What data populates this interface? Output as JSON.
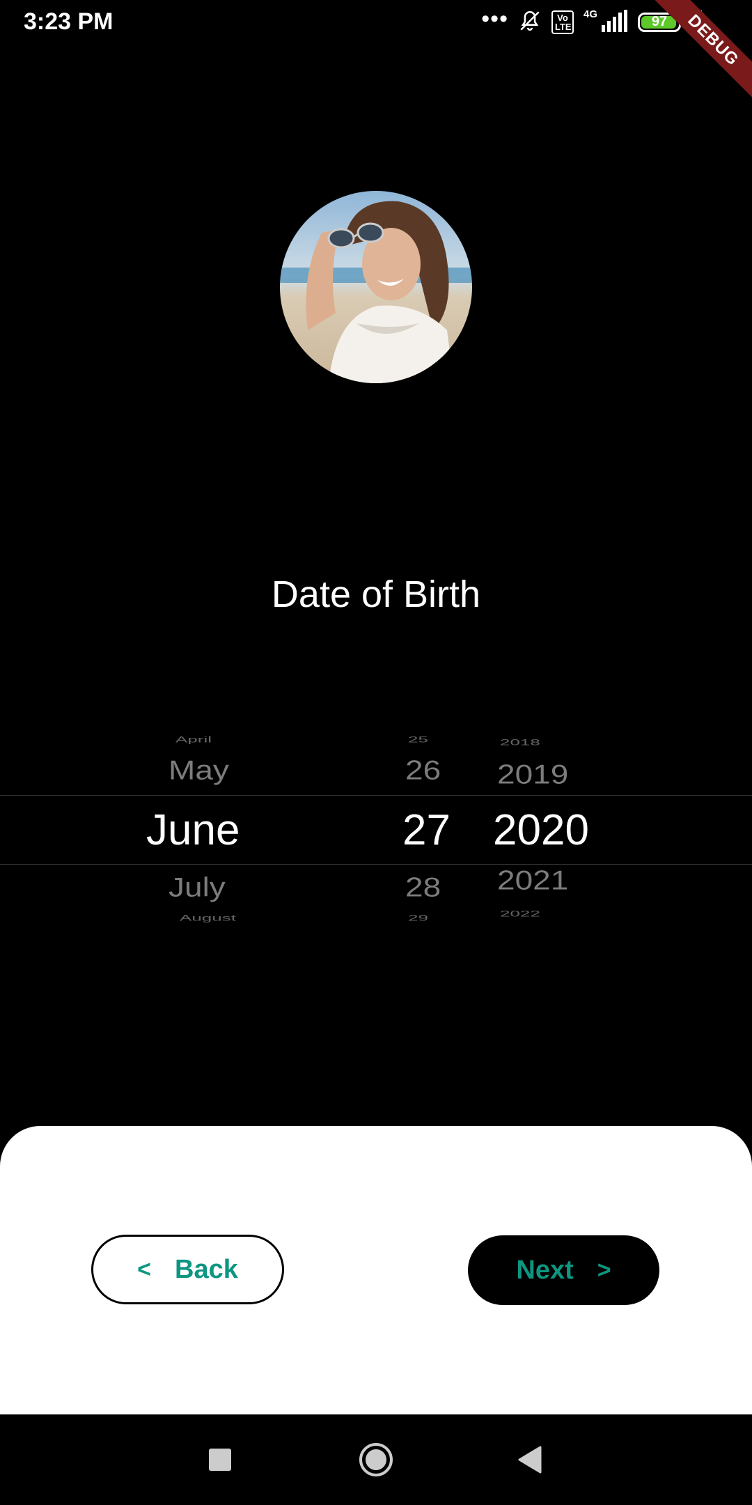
{
  "status_bar": {
    "time": "3:23 PM",
    "dots": "•••",
    "volte": "Vo LTE",
    "network": "4G",
    "battery": "97",
    "icons": [
      "mute-icon",
      "volte-icon",
      "signal-icon",
      "battery-icon",
      "charging-icon"
    ]
  },
  "debug_banner": "DEBUG",
  "title": "Date of Birth",
  "picker": {
    "months": [
      "April",
      "May",
      "June",
      "July",
      "August"
    ],
    "days": [
      "25",
      "26",
      "27",
      "28",
      "29"
    ],
    "years": [
      "2018",
      "2019",
      "2020",
      "2021",
      "2022"
    ],
    "selected": {
      "month": "June",
      "day": "27",
      "year": "2020"
    }
  },
  "buttons": {
    "back": {
      "icon": "<",
      "label": "Back"
    },
    "next": {
      "label": "Next",
      "icon": ">"
    }
  },
  "colors": {
    "accent": "#0d9681",
    "battery": "#5cc829",
    "ribbon": "#7a1a1a"
  }
}
